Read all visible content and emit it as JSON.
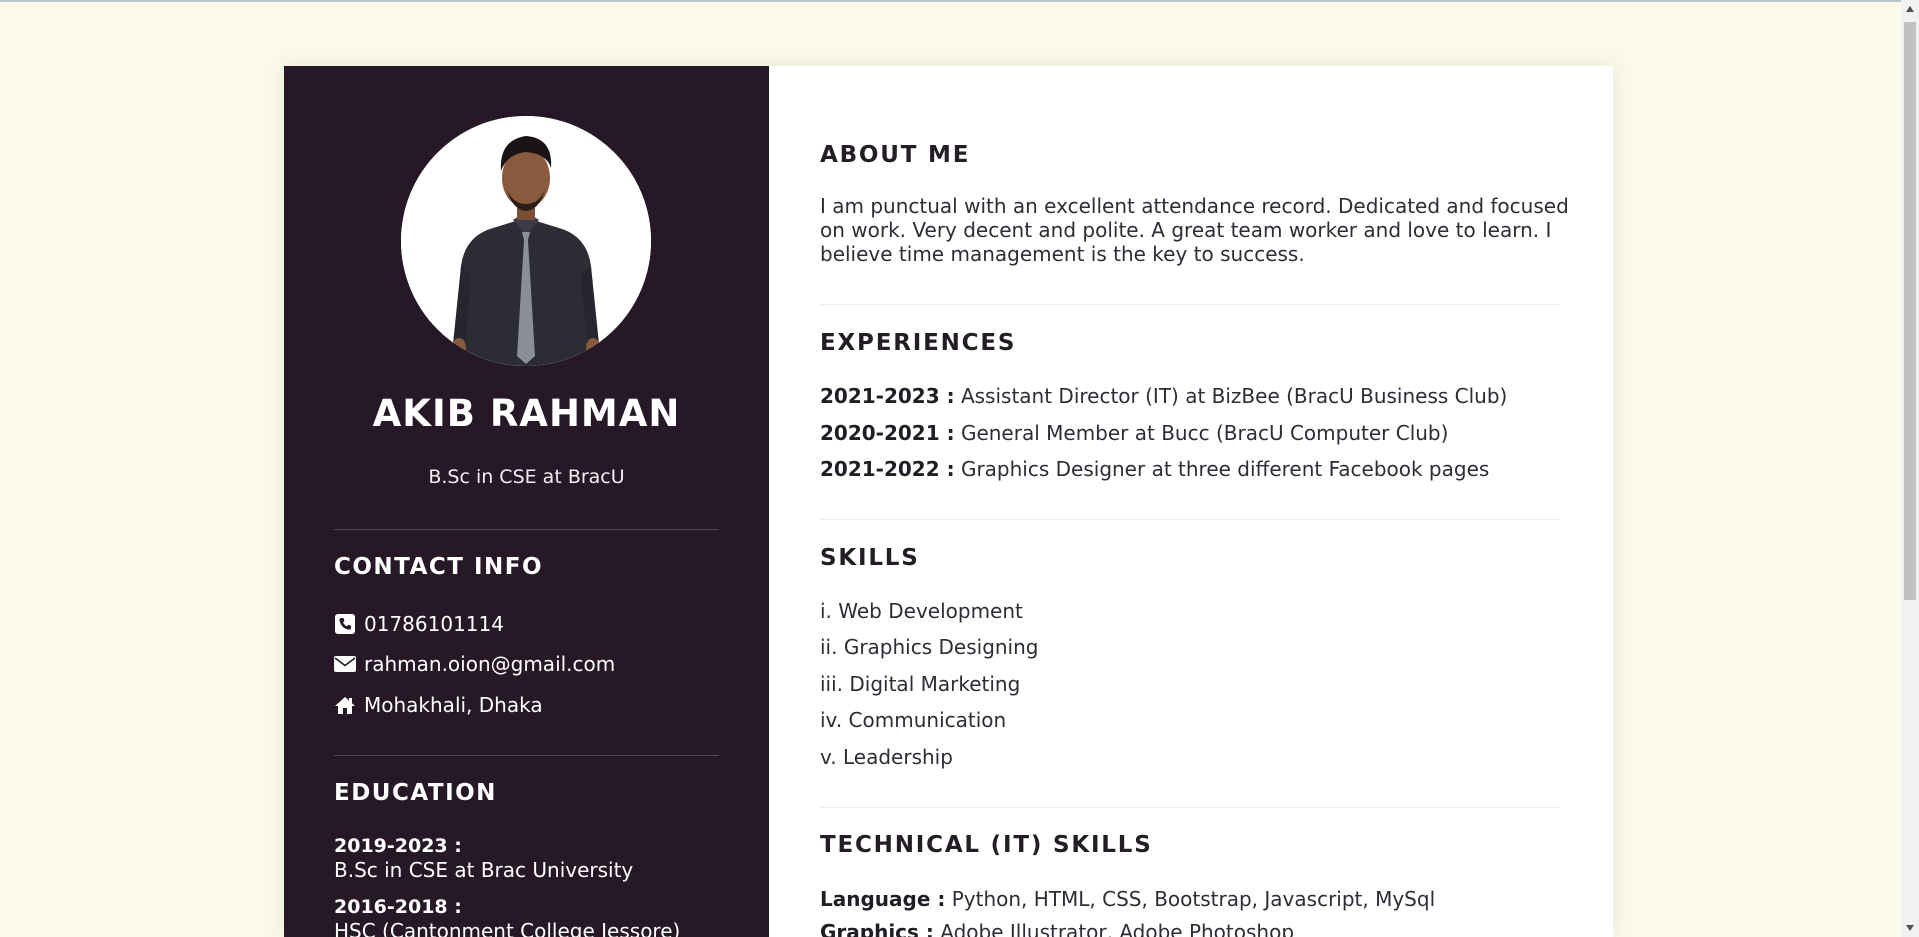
{
  "profile": {
    "name": "AKIB RAHMAN",
    "degree": "B.Sc in CSE at BracU"
  },
  "contact": {
    "title": "CONTACT INFO",
    "phone": "01786101114",
    "email": "rahman.oion@gmail.com",
    "location": "Mohakhali, Dhaka",
    "icons": [
      "phone-icon",
      "envelope-icon",
      "home-icon"
    ]
  },
  "education": {
    "title": "EDUCATION",
    "items": [
      {
        "year": "2019-2023 :",
        "desc": "B.Sc in CSE at Brac University"
      },
      {
        "year": "2016-2018 :",
        "desc": "HSC (Cantonment College Jessore)"
      }
    ]
  },
  "about": {
    "title": "ABOUT ME",
    "text": "I am punctual with an excellent attendance record. Dedicated and focused on work. Very decent and polite. A great team worker and love to learn. I believe time management is the key to success."
  },
  "experiences": {
    "title": "EXPERIENCES",
    "items": [
      {
        "year": "2021-2023 :",
        "desc": "Assistant Director (IT) at BizBee (BracU Business Club)"
      },
      {
        "year": "2020-2021 :",
        "desc": "General Member at Bucc (BracU Computer Club)"
      },
      {
        "year": "2021-2022 :",
        "desc": "Graphics Designer at three different Facebook pages"
      }
    ]
  },
  "skills": {
    "title": "SKILLS",
    "items": [
      "i. Web Development",
      "ii. Graphics Designing",
      "iii. Digital Marketing",
      "iv. Communication",
      "v. Leadership"
    ]
  },
  "technical": {
    "title": "TECHNICAL (IT) SKILLS",
    "items": [
      {
        "label": "Language :",
        "value": "Python, HTML, CSS, Bootstrap, Javascript, MySql"
      },
      {
        "label": "Graphics :",
        "value": "Adobe Illustrator, Adobe Photoshop"
      }
    ]
  },
  "colors": {
    "page_bg": "#fbfae9",
    "sidebar_bg": "#261826",
    "card_bg": "#ffffff"
  }
}
